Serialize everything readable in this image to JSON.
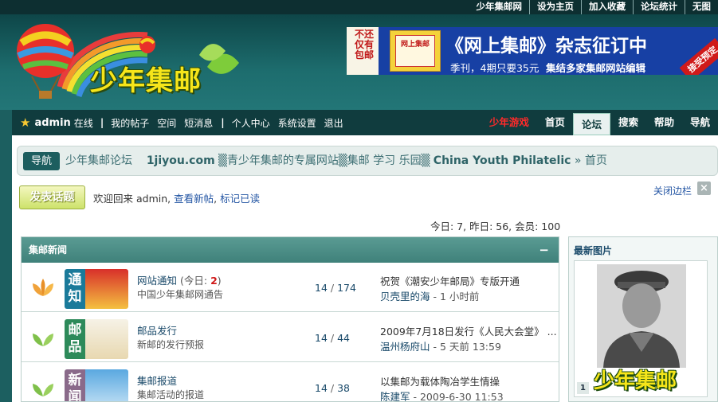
{
  "topbar": {
    "links": [
      "少年集邮网",
      "设为主页",
      "加入收藏",
      "论坛统计",
      "无图"
    ]
  },
  "header": {
    "logo_text": "少年集邮",
    "banner": {
      "side_text": "不还仅有包邮",
      "box_text": "网上集邮",
      "title": "《网上集邮》杂志征订中",
      "sub1": "季刊，4期只要35元",
      "sub2": "集结多家集邮网站编辑",
      "corner": "接受预定"
    }
  },
  "nav": {
    "username": "admin",
    "online": "在线",
    "sep": "|",
    "left_links": [
      "我的帖子",
      "空间",
      "短消息"
    ],
    "left_links2": [
      "个人中心",
      "系统设置",
      "退出"
    ],
    "right_items": [
      {
        "label": "少年游戏",
        "color": "#ff2a2a"
      },
      {
        "label": "首页"
      },
      {
        "label": "论坛",
        "active": true
      },
      {
        "label": "搜索"
      },
      {
        "label": "帮助"
      },
      {
        "label": "导航"
      }
    ]
  },
  "breadcrumb": {
    "nav_label": "导航",
    "forum_name": "少年集邮论坛",
    "site": "1jiyou.com",
    "tagline": "▒青少年集邮的专属网站▒集邮 学习 乐园▒",
    "en_name": "China Youth Philatelic",
    "tail": "» 首页"
  },
  "toolbar": {
    "post_label": "发表话题",
    "welcome": "欢迎回来 admin,",
    "view_new": "查看新帖",
    "comma": ",",
    "mark_read": "标记已读",
    "close_sidebar": "关闭边栏",
    "close_x": "×",
    "stats": "今日: 7, 昨日: 56, 会员: 100"
  },
  "section": {
    "title": "集邮新闻",
    "collapse": "−"
  },
  "forums": [
    {
      "name": "网站通知",
      "today_prefix": "(今日: ",
      "today_count": "2",
      "today_suffix": ")",
      "desc": "中国少年集邮网通告",
      "threads": "14",
      "posts": "174",
      "last_title": "祝贺《潮安少年邮局》专版开通",
      "last_user": "贝壳里的海",
      "last_time": "- 1 小时前",
      "thumb_text": [
        "通",
        "知"
      ],
      "thumb_color": "#1a7a9a",
      "leaf_color": "#f0a23a"
    },
    {
      "name": "邮品发行",
      "desc": "新邮的发行预报",
      "threads": "14",
      "posts": "44",
      "last_title": "2009年7月18日发行《人民大会堂》 ...",
      "last_user": "温州杨府山",
      "last_time": "- 5 天前 13:59",
      "thumb_text": [
        "邮",
        "品"
      ],
      "thumb_color": "#2d8a5a",
      "leaf_color": "#7fc04a"
    },
    {
      "name": "集邮报道",
      "desc": "集邮活动的报道",
      "threads": "14",
      "posts": "38",
      "last_title": "以集邮为载体陶冶学生情操",
      "last_user": "陈建军",
      "last_time": "- 2009-6-30 11:53",
      "thumb_text": [
        "新",
        "闻"
      ],
      "thumb_color": "#8a6a8a",
      "leaf_color": "#7fc04a"
    }
  ],
  "sidebar": {
    "title": "最新图片",
    "page_num": "1",
    "logo_text": "少年集邮"
  },
  "colors": {
    "header_bg": "#1c5f60",
    "nav_bg": "#103c3e",
    "section_bg": "#4a8d86",
    "accent_red": "#ff2a2a",
    "link_blue": "#2456a4"
  }
}
